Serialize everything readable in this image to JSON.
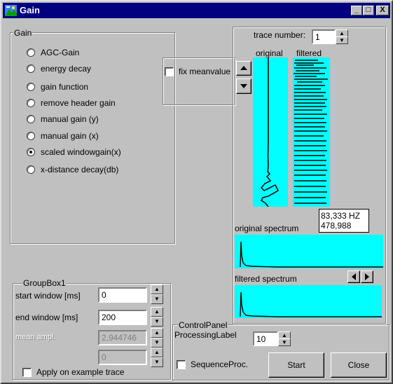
{
  "window": {
    "title": "Gain",
    "minimize": "_",
    "maximize": "□",
    "close": "X"
  },
  "gain_group": {
    "label": "Gain",
    "options": [
      {
        "label": "AGC-Gain",
        "selected": false
      },
      {
        "label": "energy decay",
        "selected": false
      },
      {
        "label": "gain function",
        "selected": false
      },
      {
        "label": "remove header gain",
        "selected": false
      },
      {
        "label": "manual gain (y)",
        "selected": false
      },
      {
        "label": "manual gain (x)",
        "selected": false
      },
      {
        "label": "scaled windowgain(x)",
        "selected": true
      },
      {
        "label": "x-distance decay(db)",
        "selected": false
      }
    ]
  },
  "meanvalue": {
    "label": "fix meanvalue",
    "checked": false
  },
  "trace": {
    "label": "trace number:",
    "value": "1",
    "original_label": "original",
    "filtered_label": "filtered",
    "readout_hz": "83,333 HZ",
    "readout_value": "478,988",
    "original_spectrum_label": "original spectrum",
    "filtered_spectrum_label": "filtered spectrum"
  },
  "groupbox1": {
    "label": "GroupBox1",
    "start_label": "start window [ms]",
    "start_value": "0",
    "end_label": "end window [ms]",
    "end_value": "200",
    "mean_label": "mean ampl.",
    "mean_value": "2,944746",
    "extra_value": "0",
    "apply_label": "Apply on example trace",
    "apply_checked": false
  },
  "control_panel": {
    "label": "ControlPanel",
    "processing_label": "ProcessingLabel",
    "processing_value": "10",
    "sequence_label": "SequenceProc.",
    "sequence_checked": false,
    "start_label": "Start",
    "close_label": "Close"
  },
  "colors": {
    "plot_bg": "#00ffff",
    "titlebar": "#000080",
    "face": "#c0c0c0"
  },
  "icons": [
    "app-landscape-icon",
    "spin-up-icon",
    "spin-down-icon",
    "arrow-left-icon",
    "arrow-right-icon"
  ]
}
